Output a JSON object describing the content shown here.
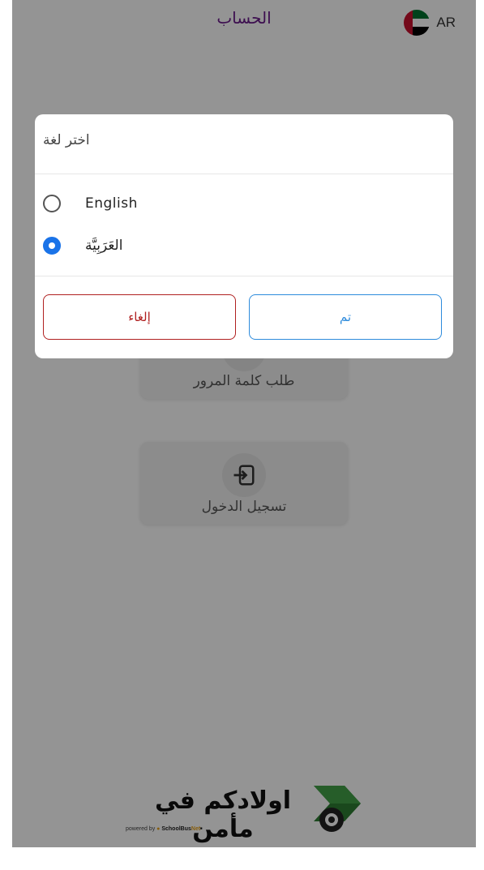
{
  "appbar": {
    "title": "الحساب",
    "lang_code": "AR",
    "flag_icon": "uae-flag-icon"
  },
  "cards": [
    {
      "label": "طلب كلمة المرور",
      "icon": "key-icon"
    },
    {
      "label": "تسجيل الدخول",
      "icon": "login-icon"
    }
  ],
  "footer": {
    "slogan": "اولادكم في مأمن",
    "powered_prefix": "powered by",
    "brand_school": "SchoolBus",
    "brand_net": "Net",
    "logo_icon": "school-bus-logo-icon"
  },
  "dialog": {
    "title": "اختر لغة",
    "options": [
      {
        "label": "English",
        "selected": false
      },
      {
        "label": "العَرَبِيَّة",
        "selected": true
      }
    ],
    "cancel_label": "إلغاء",
    "ok_label": "تم"
  },
  "colors": {
    "accent": "#1a73e8",
    "cancel": "#b02020",
    "ok": "#2d8bdc",
    "title": "#6a1b8a",
    "scrim": "rgba(0,0,0,0.42)"
  }
}
